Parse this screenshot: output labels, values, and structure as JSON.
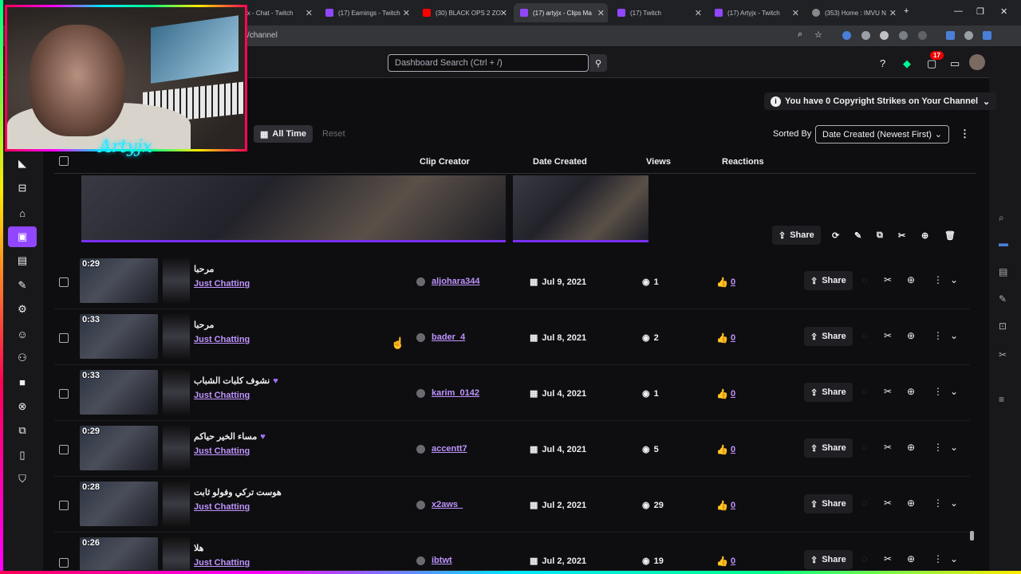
{
  "browser": {
    "tabs": [
      {
        "label": "jx - Chat - Twitch"
      },
      {
        "label": "(17) Earnings - Twitch"
      },
      {
        "label": "(30) BLACK OPS 2 ZO"
      },
      {
        "label": "(17) artyjx - Clips Ma"
      },
      {
        "label": "(17) Twitch"
      },
      {
        "label": "(17) Artyjx - Twitch"
      },
      {
        "label": "(353) Home : IMVU N"
      }
    ],
    "url": "/channel"
  },
  "topnav": {
    "search_placeholder": "Dashboard Search (Ctrl + /)",
    "notification_count": "17"
  },
  "overlay": {
    "logo_text": "Artyjx"
  },
  "banner": {
    "strikes_text": "You have 0 Copyright Strikes on Your Channel"
  },
  "filters": {
    "all_time_label": "All Time",
    "reset_label": "Reset",
    "sorted_by_label": "Sorted By",
    "sort_value": "Date Created (Newest First)"
  },
  "table": {
    "headers": {
      "creator": "Clip Creator",
      "date": "Date Created",
      "views": "Views",
      "reactions": "Reactions"
    },
    "expanded_share_label": "Share",
    "rows": [
      {
        "duration": "0:29",
        "title": "مرحبا",
        "heart": "",
        "category": "Just Chatting",
        "creator": "aljohara344",
        "date": "Jul 9, 2021",
        "views": "1",
        "reactions": "0",
        "share": "Share"
      },
      {
        "duration": "0:33",
        "title": "مرحبا",
        "heart": "",
        "category": "Just Chatting",
        "creator": "bader_4",
        "date": "Jul 8, 2021",
        "views": "2",
        "reactions": "0",
        "share": "Share"
      },
      {
        "duration": "0:33",
        "title": "نشوف كلبات الشباب",
        "heart": "♥",
        "category": "Just Chatting",
        "creator": "karim_0142",
        "date": "Jul 4, 2021",
        "views": "1",
        "reactions": "0",
        "share": "Share"
      },
      {
        "duration": "0:29",
        "title": "مساء الخير حياكم",
        "heart": "♥",
        "category": "Just Chatting",
        "creator": "accentt7",
        "date": "Jul 4, 2021",
        "views": "5",
        "reactions": "0",
        "share": "Share"
      },
      {
        "duration": "0:28",
        "title": "هوست تركي وفولو ثابت",
        "heart": "",
        "category": "Just Chatting",
        "creator": "x2aws_",
        "date": "Jul 2, 2021",
        "views": "29",
        "reactions": "0",
        "share": "Share"
      },
      {
        "duration": "0:26",
        "title": "هلا",
        "heart": "",
        "category": "Just Chatting",
        "creator": "ibtwt",
        "date": "Jul 2, 2021",
        "views": "19",
        "reactions": "0",
        "share": "Share"
      }
    ]
  },
  "colors": {
    "accent": "#9147ff",
    "link": "#bf94ff",
    "background": "#0e0e10"
  }
}
